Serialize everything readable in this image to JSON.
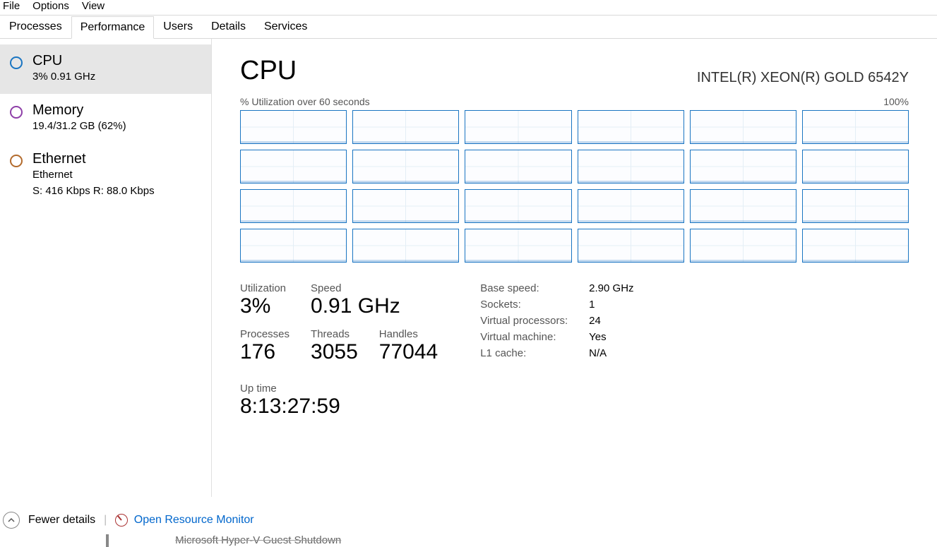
{
  "menu": {
    "file": "File",
    "options": "Options",
    "view": "View"
  },
  "tabs": {
    "processes": "Processes",
    "performance": "Performance",
    "users": "Users",
    "details": "Details",
    "services": "Services"
  },
  "sidebar": {
    "cpu": {
      "title": "CPU",
      "sub": "3% 0.91 GHz"
    },
    "memory": {
      "title": "Memory",
      "sub": "19.4/31.2 GB (62%)"
    },
    "ethernet": {
      "title": "Ethernet",
      "sub1": "Ethernet",
      "sub2": "S: 416 Kbps R: 88.0 Kbps"
    }
  },
  "main": {
    "title": "CPU",
    "model": "INTEL(R) XEON(R) GOLD 6542Y",
    "chart_label": "% Utilization over 60 seconds",
    "chart_max": "100%",
    "utilization_label": "Utilization",
    "utilization_value": "3%",
    "speed_label": "Speed",
    "speed_value": "0.91 GHz",
    "processes_label": "Processes",
    "processes_value": "176",
    "threads_label": "Threads",
    "threads_value": "3055",
    "handles_label": "Handles",
    "handles_value": "77044",
    "uptime_label": "Up time",
    "uptime_value": "8:13:27:59",
    "right": {
      "base_speed_k": "Base speed:",
      "base_speed_v": "2.90 GHz",
      "sockets_k": "Sockets:",
      "sockets_v": "1",
      "vprocs_k": "Virtual processors:",
      "vprocs_v": "24",
      "vm_k": "Virtual machine:",
      "vm_v": "Yes",
      "l1_k": "L1 cache:",
      "l1_v": "N/A"
    }
  },
  "footer": {
    "fewer": "Fewer details",
    "open_rm": "Open Resource Monitor"
  },
  "clipped_text": "Microsoft Hyper-V Guest Shutdown",
  "chart_data": {
    "type": "area",
    "title": "% Utilization over 60 seconds",
    "ylim": [
      0,
      100
    ],
    "ylabel": "% Utilization",
    "xlabel": "60 seconds window",
    "cores": 24,
    "note": "Each of 24 logical processors shows ~1-5% utilization over the 60s window; values not labeled per-core."
  }
}
